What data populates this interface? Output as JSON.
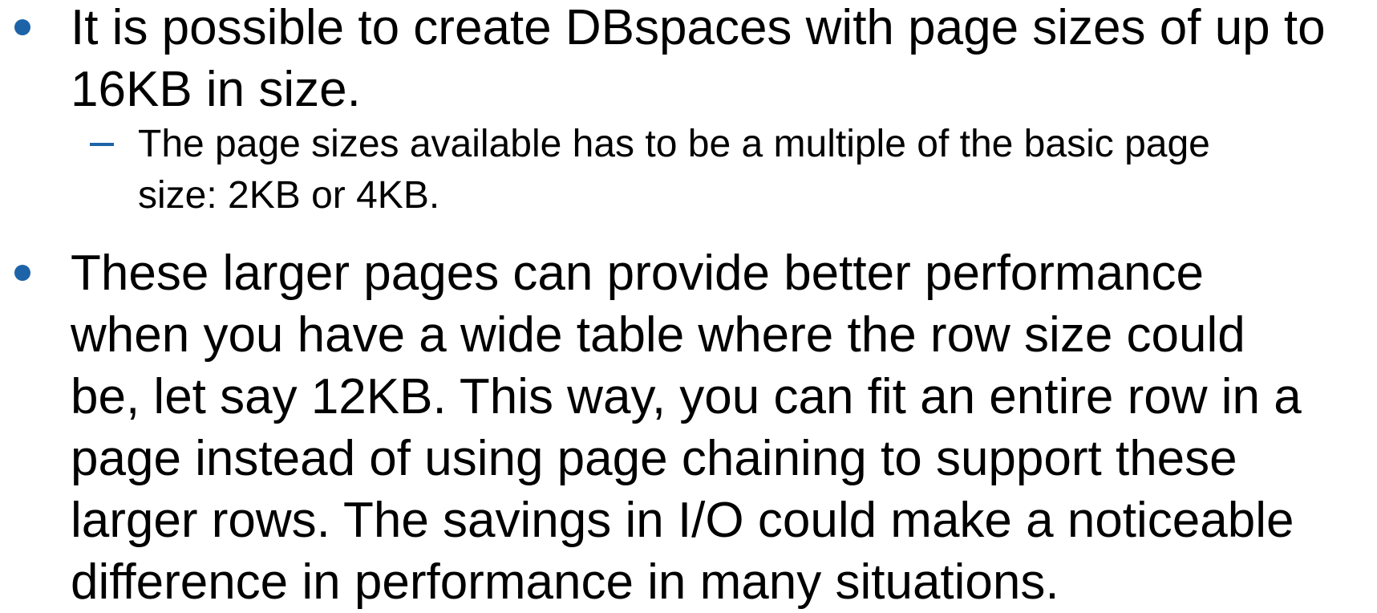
{
  "colors": {
    "bullet": "#1d63a8",
    "text": "#000000",
    "background": "#ffffff"
  },
  "bullets": [
    {
      "marker": "bullet-dot",
      "text": "It is possible to create DBspaces with page sizes of up to\n16KB in size."
    },
    {
      "marker": "bullet-dot",
      "text": "These larger pages can provide better performance\nwhen you have a wide table where the row size could\nbe, let say 12KB. This way, you can fit an entire row in a\npage instead of using page chaining to support these\nlarger rows. The savings in I/O could make a noticeable\ndifference in performance in many situations."
    }
  ],
  "sub_bullets": [
    {
      "marker": "en-dash",
      "text": "The page sizes available has to be a multiple of the basic page\nsize: 2KB or 4KB."
    }
  ]
}
